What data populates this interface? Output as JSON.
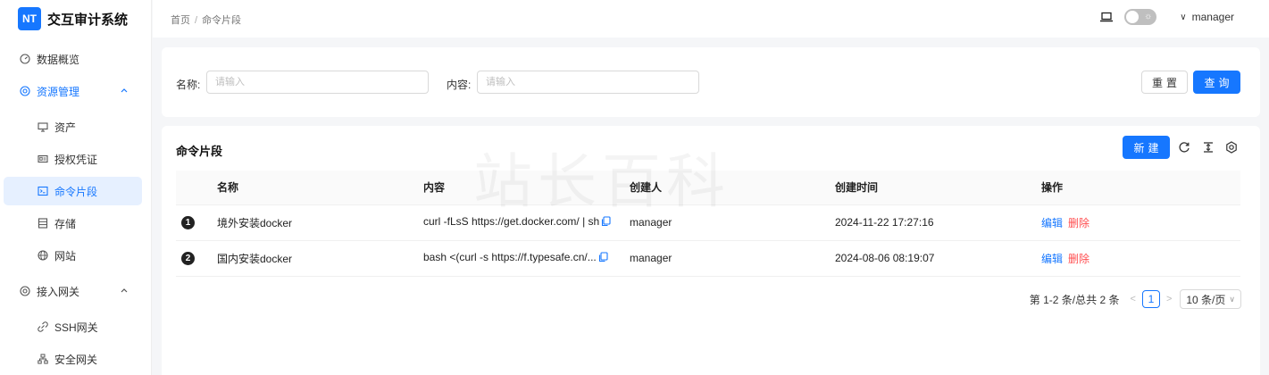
{
  "app": {
    "logo_badge": "NT",
    "title": "交互审计系统"
  },
  "sidebar": {
    "items": [
      {
        "label": "数据概览",
        "icon": "dashboard-icon",
        "level": "top"
      },
      {
        "label": "资源管理",
        "icon": "cloud-icon",
        "level": "top",
        "state": "open",
        "arrow": "^"
      },
      {
        "label": "资产",
        "icon": "monitor-icon",
        "level": "sub"
      },
      {
        "label": "授权凭证",
        "icon": "id-card-icon",
        "level": "sub"
      },
      {
        "label": "命令片段",
        "icon": "terminal-icon",
        "level": "sub",
        "state": "selected"
      },
      {
        "label": "存储",
        "icon": "storage-icon",
        "level": "sub"
      },
      {
        "label": "网站",
        "icon": "globe-icon",
        "level": "sub"
      },
      {
        "label": "接入网关",
        "icon": "gateway-icon",
        "level": "top",
        "arrow": "^"
      },
      {
        "label": "SSH网关",
        "icon": "link-icon",
        "level": "sub"
      },
      {
        "label": "安全网关",
        "icon": "cluster-icon",
        "level": "sub"
      }
    ]
  },
  "header": {
    "breadcrumb": [
      "首页",
      "命令片段"
    ],
    "breadcrumb_sep": "/",
    "user": "manager",
    "user_chevron": "∨"
  },
  "search": {
    "name_label": "名称:",
    "name_placeholder": "请输入",
    "content_label": "内容:",
    "content_placeholder": "请输入",
    "reset_label": "重置",
    "query_label": "查询"
  },
  "table": {
    "title": "命令片段",
    "new_label": "新建",
    "columns": [
      "",
      "名称",
      "内容",
      "创建人",
      "创建时间",
      "操作"
    ],
    "rows": [
      {
        "index": "1",
        "name": "境外安装docker",
        "content": "curl -fLsS https://get.docker.com/ | sh",
        "creator": "manager",
        "created": "2024-11-22 17:27:16",
        "edit": "编辑",
        "delete": "删除"
      },
      {
        "index": "2",
        "name": "国内安装docker",
        "content": "bash <(curl -s https://f.typesafe.cn/...",
        "creator": "manager",
        "created": "2024-08-06 08:19:07",
        "edit": "编辑",
        "delete": "删除"
      }
    ]
  },
  "pagination": {
    "summary": "第 1-2 条/总共 2 条",
    "prev": "<",
    "current": "1",
    "next": ">",
    "page_size": "10 条/页"
  },
  "watermark": "站长百科",
  "colors": {
    "primary": "#1677ff",
    "danger": "#ff4d4f",
    "selected_bg": "#e6f0ff"
  }
}
